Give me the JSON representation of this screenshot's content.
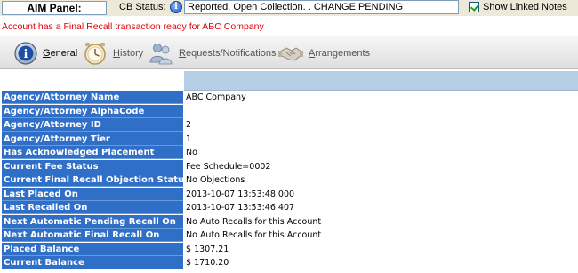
{
  "top": {
    "panel_title": "AIM Panel:",
    "cb_status_label": "CB Status:",
    "cb_status_value": "Reported. Open Collection. . CHANGE PENDING",
    "show_linked_notes_label": "Show Linked Notes",
    "show_linked_notes_checked": true
  },
  "recall_message": "Account has a Final Recall transaction ready for ABC Company",
  "tabs": [
    {
      "first": "G",
      "rest": "eneral",
      "icon": "info-icon",
      "active": true
    },
    {
      "first": "H",
      "rest": "istory",
      "icon": "clock-icon",
      "active": false
    },
    {
      "first": "R",
      "rest": "equests/Notifications",
      "icon": "people-icon",
      "active": false
    },
    {
      "first": "A",
      "rest": "rrangements",
      "icon": "handshake-icon",
      "active": false
    }
  ],
  "properties": [
    {
      "label": "Agency/Attorney Name",
      "value": "ABC Company"
    },
    {
      "label": "Agency/Attorney AlphaCode",
      "value": ""
    },
    {
      "label": "Agency/Attorney ID",
      "value": "2"
    },
    {
      "label": "Agency/Attorney Tier",
      "value": "1"
    },
    {
      "label": "Has Acknowledged Placement",
      "value": "No"
    },
    {
      "label": "Current Fee Status",
      "value": "Fee Schedule=0002"
    },
    {
      "label": "Current Final Recall Objection Status",
      "value": "No Objections"
    },
    {
      "label": "Last Placed On",
      "value": "2013-10-07 13:53:48.000"
    },
    {
      "label": "Last Recalled On",
      "value": "2013-10-07 13:53:46.407"
    },
    {
      "label": "Next Automatic Pending Recall On",
      "value": "No Auto Recalls for this Account"
    },
    {
      "label": "Next Automatic Final Recall On",
      "value": "No Auto Recalls for this Account"
    },
    {
      "label": "Placed Balance",
      "value": "$ 1307.21"
    },
    {
      "label": "Current Balance",
      "value": "$ 1710.20"
    }
  ]
}
